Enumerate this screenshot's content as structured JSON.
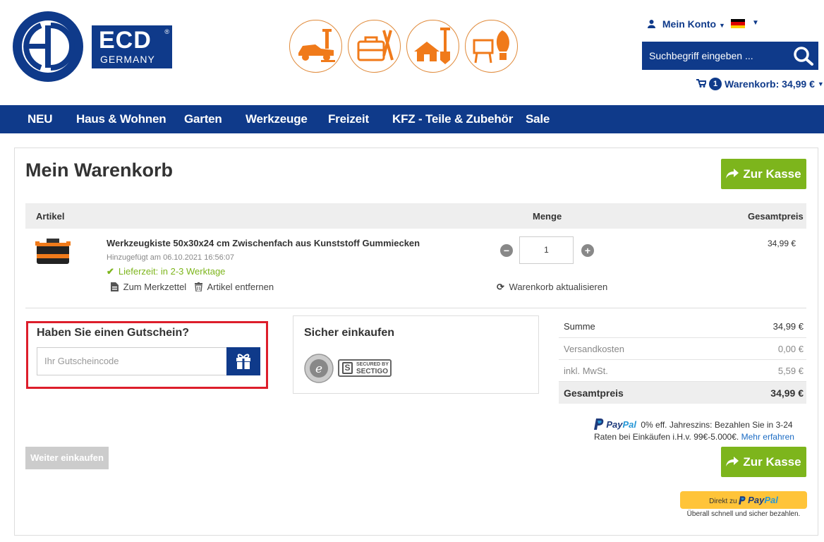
{
  "header": {
    "logo": {
      "brand": "ECD",
      "sub": "GERMANY",
      "reg": "®"
    },
    "account_label": "Mein Konto",
    "search_placeholder": "Suchbegriff eingeben ...",
    "cart": {
      "count": "1",
      "label": "Warenkorb: 34,99 €"
    },
    "category_icons": [
      "car-jack-icon",
      "toolbox-icon",
      "house-shovel-icon",
      "lamp-bulb-icon"
    ]
  },
  "nav": {
    "items": [
      "NEU",
      "Haus & Wohnen",
      "Garten",
      "Werkzeuge",
      "Freizeit",
      "KFZ - Teile & Zubehör",
      "Sale"
    ]
  },
  "cart_page": {
    "title": "Mein Warenkorb",
    "checkout_label": "Zur Kasse",
    "columns": {
      "article": "Artikel",
      "quantity": "Menge",
      "total": "Gesamtpreis"
    },
    "item": {
      "name": "Werkzeugkiste 50x30x24 cm Zwischenfach aus Kunststoff Gummiecken",
      "added": "Hinzugefügt am 06.10.2021 16:56:07",
      "delivery": "Lieferzeit: in 2-3 Werktage",
      "wishlist": "Zum Merkzettel",
      "remove": "Artikel entfernen",
      "quantity": "1",
      "price": "34,99 €"
    },
    "update_label": "Warenkorb aktualisieren",
    "coupon": {
      "title": "Haben Sie einen Gutschein?",
      "placeholder": "Ihr Gutscheincode"
    },
    "safe": {
      "title": "Sicher einkaufen",
      "sectigo_line1": "SECURED BY",
      "sectigo_line2": "SECTIGO"
    },
    "totals": [
      {
        "label": "Summe",
        "value": "34,99 €"
      },
      {
        "label": "Versandkosten",
        "value": "0,00 €"
      },
      {
        "label": "inkl. MwSt.",
        "value": "5,59 €"
      }
    ],
    "grand_total": {
      "label": "Gesamtpreis",
      "value": "34,99 €"
    },
    "paypal": {
      "brand_a": "Pay",
      "brand_b": "Pal",
      "text": "0% eff. Jahreszins: Bezahlen Sie in 3-24 Raten bei Einkäufen i.H.v. 99€-5.000€.",
      "link": "Mehr erfahren"
    },
    "continue_label": "Weiter einkaufen",
    "paypal_button": {
      "prefix": "Direkt zu",
      "tagline": "Überall schnell und sicher bezahlen."
    }
  },
  "colors": {
    "brand_blue": "#0f3a8a",
    "green": "#7db51c",
    "orange": "#f07a1a",
    "red_highlight": "#dd1e2b"
  }
}
